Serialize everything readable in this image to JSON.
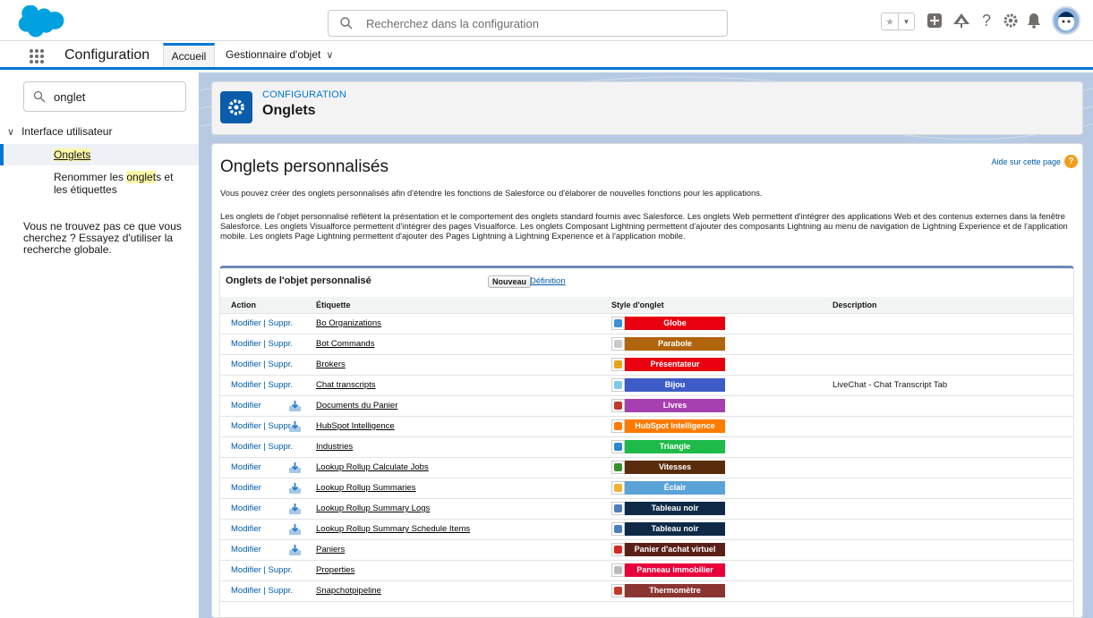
{
  "header": {
    "search_placeholder": "Recherchez dans la configuration",
    "icons": [
      "favorites-star-icon",
      "favorites-dropdown-icon",
      "add-icon",
      "trailhead-icon",
      "help-icon",
      "setup-gear-icon",
      "notifications-bell-icon",
      "avatar"
    ]
  },
  "context": {
    "app_name": "Configuration",
    "tab_home": "Accueil",
    "tab_object_manager": "Gestionnaire d'objet"
  },
  "sidebar": {
    "search_value": "onglet",
    "group_label": "Interface utilisateur",
    "item_active": "Onglets",
    "item2_pre": "Renommer les ",
    "item2_hl": "onglet",
    "item2_post": "s et les étiquettes",
    "help_text": "Vous ne trouvez pas ce que vous cherchez ? Essayez d'utiliser la recherche globale."
  },
  "page_header": {
    "kicker": "CONFIGURATION",
    "title": "Onglets"
  },
  "content": {
    "title": "Onglets personnalisés",
    "help_link": "Aide sur cette page",
    "para1": "Vous pouvez créer des onglets personnalisés afin d'étendre les fonctions de Salesforce ou d'élaborer de nouvelles fonctions pour les applications.",
    "para2": "Les onglets de l'objet personnalisé reflètent la présentation et le comportement des onglets standard fournis avec Salesforce. Les onglets Web permettent d'intégrer des applications Web et des contenus externes dans la fenêtre Salesforce. Les onglets Visualforce permettent d'intégrer des pages Visualforce. Les onglets Composant Lightning permettent d'ajouter des composants Lightning au menu de navigation de Lightning Experience et de l'application mobile. Les onglets Page Lightning permettent d'ajouter des Pages Lightning à Lightning Experience et à l'application mobile."
  },
  "table": {
    "title": "Onglets de l'objet personnalisé",
    "new_button": "Nouveau",
    "definition_link": "Définition",
    "columns": [
      "Action",
      "Étiquette",
      "Style d'onglet",
      "Description"
    ],
    "action_modify": "Modifier",
    "action_sep": " | ",
    "action_delete": "Suppr.",
    "rows": [
      {
        "delete": true,
        "installed": false,
        "label": "Bo Organizations",
        "style": "Globe",
        "color": "#e8000e",
        "icon_color": "#3a8fd8",
        "description": ""
      },
      {
        "delete": true,
        "installed": false,
        "label": "Bot Commands",
        "style": "Parabole",
        "color": "#b0640c",
        "icon_color": "#c9c9c9",
        "description": ""
      },
      {
        "delete": true,
        "installed": false,
        "label": "Brokers",
        "style": "Présentateur",
        "color": "#e8000e",
        "icon_color": "#e8a21b",
        "description": ""
      },
      {
        "delete": true,
        "installed": false,
        "label": "Chat transcripts",
        "style": "Bijou",
        "color": "#3d5cc7",
        "icon_color": "#7fc8e8",
        "description": "LiveChat - Chat Transcript Tab"
      },
      {
        "delete": false,
        "installed": true,
        "label": "Documents du Panier",
        "style": "Livres",
        "color": "#a640b0",
        "icon_color": "#c0392b",
        "description": ""
      },
      {
        "delete": true,
        "installed": true,
        "label": "HubSpot Intelligence",
        "style": "HubSpot Intelligence",
        "color": "#ff7a00",
        "icon_color": "#ff7a00",
        "description": ""
      },
      {
        "delete": true,
        "installed": false,
        "label": "Industries",
        "style": "Triangle",
        "color": "#1fbb4a",
        "icon_color": "#2e88c9",
        "description": ""
      },
      {
        "delete": false,
        "installed": true,
        "label": "Lookup Rollup Calculate Jobs",
        "style": "Vitesses",
        "color": "#5a2c0c",
        "icon_color": "#3b8f2c",
        "description": ""
      },
      {
        "delete": false,
        "installed": true,
        "label": "Lookup Rollup Summaries",
        "style": "Éclair",
        "color": "#5aa3d8",
        "icon_color": "#f2b233",
        "description": ""
      },
      {
        "delete": false,
        "installed": true,
        "label": "Lookup Rollup Summary Logs",
        "style": "Tableau noir",
        "color": "#0e2a47",
        "icon_color": "#4e7fb8",
        "description": ""
      },
      {
        "delete": false,
        "installed": true,
        "label": "Lookup Rollup Summary Schedule Items",
        "style": "Tableau noir",
        "color": "#0e2a47",
        "icon_color": "#4e7fb8",
        "description": ""
      },
      {
        "delete": false,
        "installed": true,
        "label": "Paniers",
        "style": "Panier d'achat virtuel",
        "color": "#5a2018",
        "icon_color": "#d42b1f",
        "description": ""
      },
      {
        "delete": true,
        "installed": false,
        "label": "Properties",
        "style": "Panneau immobilier",
        "color": "#e8003c",
        "icon_color": "#bbbbbb",
        "description": ""
      },
      {
        "delete": true,
        "installed": false,
        "label": "Snapchotpipeline",
        "style": "Thermomètre",
        "color": "#8b3533",
        "icon_color": "#c0392b",
        "description": ""
      }
    ]
  },
  "colors": {
    "brand": "#0176d3",
    "link": "#015ba7",
    "background": "#b6cbe3"
  }
}
